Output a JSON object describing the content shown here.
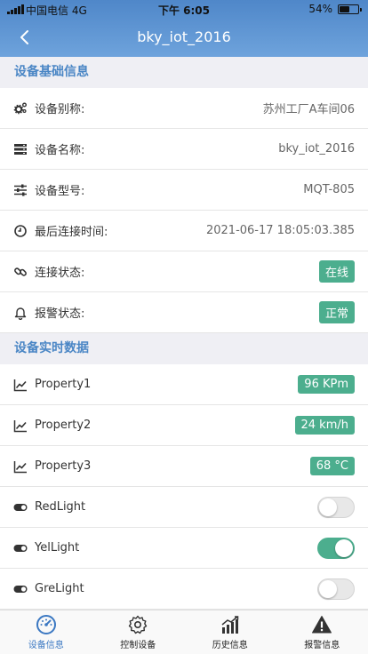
{
  "status_bar": {
    "carrier": "中国电信  4G",
    "time": "下午 6:05",
    "battery": "54%",
    "battery_level": 0.54
  },
  "nav": {
    "title": "bky_iot_2016",
    "back_icon": "chevron-left-icon"
  },
  "basic_section": {
    "title": "设备基础信息",
    "rows": [
      {
        "icon": "gears-icon",
        "label": "设备别称:",
        "value": "苏州工厂A车间06"
      },
      {
        "icon": "server-icon",
        "label": "设备名称:",
        "value": "bky_iot_2016"
      },
      {
        "icon": "sliders-icon",
        "label": "设备型号:",
        "value": "MQT-805"
      },
      {
        "icon": "clock-icon",
        "label": "最后连接时间:",
        "value": "2021-06-17 18:05:03.385"
      },
      {
        "icon": "link-icon",
        "label": "连接状态:",
        "value": "在线"
      },
      {
        "icon": "bell-icon",
        "label": "报警状态:",
        "value": "正常"
      }
    ]
  },
  "realtime_section": {
    "title": "设备实时数据",
    "properties": [
      {
        "icon": "line-chart-icon",
        "label": "Property1",
        "value": "96 KPm"
      },
      {
        "icon": "line-chart-icon",
        "label": "Property2",
        "value": "24 km/h"
      },
      {
        "icon": "line-chart-icon",
        "label": "Property3",
        "value": "68 °C"
      }
    ],
    "switches": [
      {
        "icon": "toggle-icon",
        "label": "RedLight",
        "on": false
      },
      {
        "icon": "toggle-icon",
        "label": "YelLight",
        "on": true
      },
      {
        "icon": "toggle-icon",
        "label": "GreLight",
        "on": false
      }
    ]
  },
  "tabbar": {
    "tabs": [
      {
        "icon": "dashboard-icon",
        "label": "设备信息",
        "active": true
      },
      {
        "icon": "gear-icon",
        "label": "控制设备",
        "active": false
      },
      {
        "icon": "bar-chart-icon",
        "label": "历史信息",
        "active": false
      },
      {
        "icon": "warning-icon",
        "label": "报警信息",
        "active": false
      }
    ]
  },
  "colors": {
    "header_top": "#4f87c9",
    "header_bottom": "#6ea3dc",
    "section_text": "#4a86c5",
    "badge": "#4cae8e",
    "tab_active": "#3b78c2"
  }
}
